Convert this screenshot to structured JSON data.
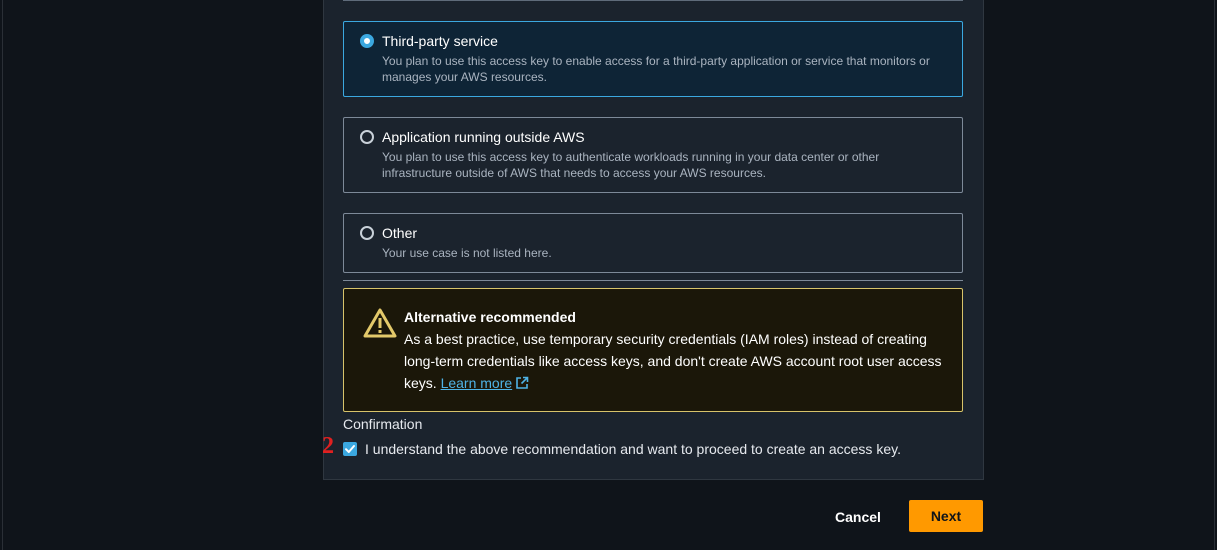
{
  "use_case_options": [
    {
      "title": "Third-party service",
      "description": "You plan to use this access key to enable access for a third-party application or service that monitors or manages your AWS resources.",
      "selected": true
    },
    {
      "title": "Application running outside AWS",
      "description": "You plan to use this access key to authenticate workloads running in your data center or other infrastructure outside of AWS that needs to access your AWS resources.",
      "selected": false
    },
    {
      "title": "Other",
      "description": "Your use case is not listed here.",
      "selected": false
    }
  ],
  "alert": {
    "icon": "warning-icon",
    "title": "Alternative recommended",
    "body": "As a best practice, use temporary security credentials (IAM roles) instead of creating long-term credentials like access keys, and don't create AWS account root user access keys.",
    "link_text": "Learn more",
    "link_icon": "external-link-icon"
  },
  "confirmation": {
    "label": "Confirmation",
    "checkbox_text": "I understand the above recommendation and want to proceed to create an access key.",
    "checked": true,
    "step_marker": "2"
  },
  "actions": {
    "cancel_label": "Cancel",
    "next_label": "Next"
  },
  "colors": {
    "accent": "#3ba8e0",
    "primary_button": "#ff9900",
    "warning_border": "#d7c36a",
    "marker": "#e02020"
  }
}
